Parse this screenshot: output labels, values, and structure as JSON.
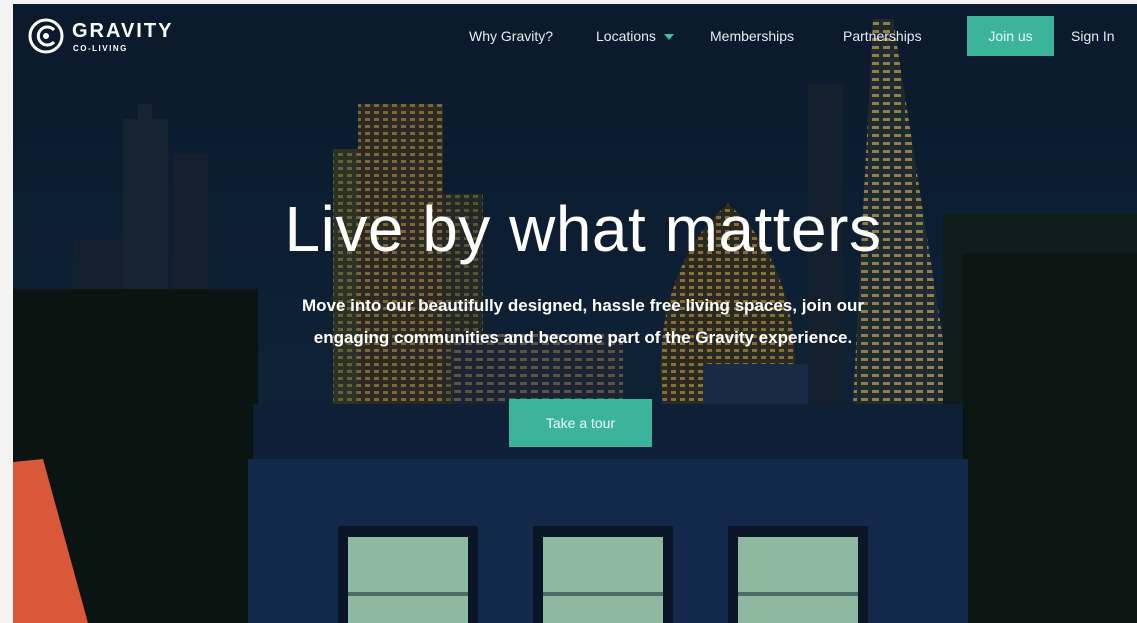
{
  "brand": {
    "name": "GRAVITY",
    "tagline": "CO-LIVING",
    "accent_color": "#3bb49a",
    "logo_icon": "gravity-logo-icon"
  },
  "nav": {
    "items": [
      {
        "label": "Why Gravity?"
      },
      {
        "label": "Locations",
        "icon": "caret-down-icon"
      },
      {
        "label": "Memberships"
      },
      {
        "label": "Partnerships"
      }
    ],
    "join_label": "Join us",
    "signin_label": "Sign In"
  },
  "hero": {
    "headline": "Live by what matters",
    "subtitle_line1": "Move into our beautifully designed, hassle free living spaces, join our",
    "subtitle_line2": "engaging communities and become part of the Gravity experience.",
    "cta_label": "Take a tour",
    "background": "illustrated-night-city-skyline"
  }
}
